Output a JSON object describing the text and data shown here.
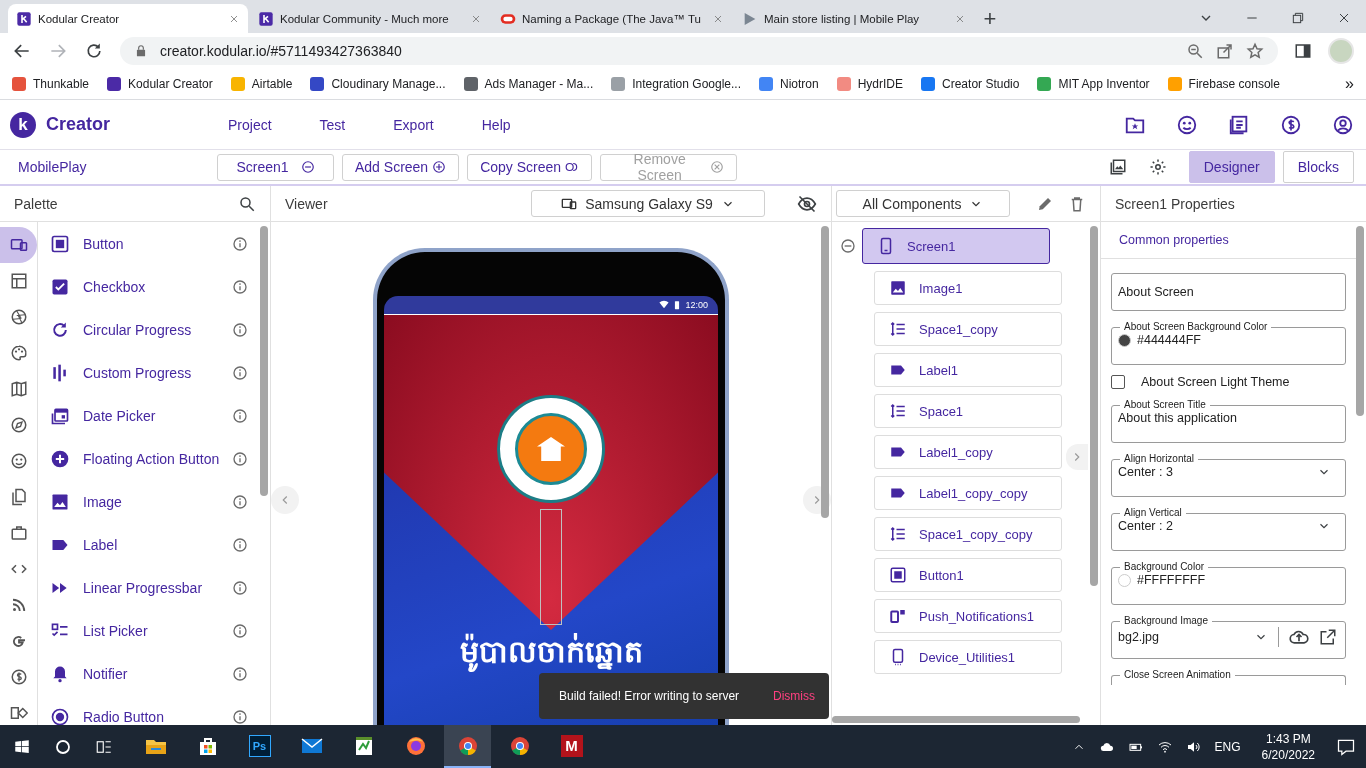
{
  "browser": {
    "tabs": [
      {
        "title": "Kodular Creator",
        "kind": "kodular",
        "selected": true
      },
      {
        "title": "Kodular Community - Much more",
        "kind": "kodular",
        "selected": false
      },
      {
        "title": "Naming a Package (The Java™ Tu",
        "kind": "oracle",
        "selected": false
      },
      {
        "title": "Main store listing | Mobile Play",
        "kind": "play",
        "selected": false
      }
    ],
    "new_tab": "+",
    "url": "creator.kodular.io/#5711493427363840",
    "bookmarks": [
      {
        "label": "Thunkable",
        "color": "#e5533d"
      },
      {
        "label": "Kodular Creator",
        "color": "#4b2aa6"
      },
      {
        "label": "Airtable",
        "color": "#f8b400"
      },
      {
        "label": "Cloudinary Manage...",
        "color": "#3448c5"
      },
      {
        "label": "Ads Manager - Ma...",
        "color": "#5f6368"
      },
      {
        "label": "Integration Google...",
        "color": "#9aa0a6"
      },
      {
        "label": "Niotron",
        "color": "#4285f4"
      },
      {
        "label": "HydrIDE",
        "color": "#f28b82"
      },
      {
        "label": "Creator Studio",
        "color": "#1877f2"
      },
      {
        "label": "MIT App Inventor",
        "color": "#34a853"
      },
      {
        "label": "Firebase console",
        "color": "#ffa000"
      }
    ],
    "more": "»"
  },
  "app": {
    "logo": "k",
    "title": "Creator",
    "menu": [
      "Project",
      "Test",
      "Export",
      "Help"
    ]
  },
  "toolbar": {
    "project": "MobilePlay",
    "screen": "Screen1",
    "buttons": [
      {
        "label": "Add Screen",
        "kind": "add",
        "disabled": false
      },
      {
        "label": "Copy Screen",
        "kind": "copy",
        "disabled": false
      },
      {
        "label": "Remove Screen",
        "kind": "remove",
        "disabled": true
      }
    ],
    "modes": [
      {
        "label": "Designer",
        "selected": true
      },
      {
        "label": "Blocks",
        "selected": false
      }
    ]
  },
  "palette": {
    "title": "Palette",
    "categories": [
      {
        "kind": "ui",
        "selected": true
      },
      {
        "kind": "layout",
        "selected": false
      },
      {
        "kind": "media",
        "selected": false
      },
      {
        "kind": "drawing",
        "selected": false
      },
      {
        "kind": "map",
        "selected": false
      },
      {
        "kind": "sensor",
        "selected": false
      },
      {
        "kind": "social",
        "selected": false
      },
      {
        "kind": "storage",
        "selected": false
      },
      {
        "kind": "utilities",
        "selected": false
      },
      {
        "kind": "code",
        "selected": false
      },
      {
        "kind": "connectivity",
        "selected": false
      },
      {
        "kind": "google",
        "selected": false
      },
      {
        "kind": "monetization",
        "selected": false
      },
      {
        "kind": "extension",
        "selected": false
      }
    ],
    "items": [
      {
        "label": "Button",
        "kind": "button"
      },
      {
        "label": "Checkbox",
        "kind": "checkbox"
      },
      {
        "label": "Circular Progress",
        "kind": "circular"
      },
      {
        "label": "Custom Progress",
        "kind": "bars"
      },
      {
        "label": "Date Picker",
        "kind": "calendar"
      },
      {
        "label": "Floating Action Button",
        "kind": "fab"
      },
      {
        "label": "Image",
        "kind": "image"
      },
      {
        "label": "Label",
        "kind": "label"
      },
      {
        "label": "Linear Progressbar",
        "kind": "play"
      },
      {
        "label": "List Picker",
        "kind": "list"
      },
      {
        "label": "Notifier",
        "kind": "bell"
      },
      {
        "label": "Radio Button",
        "kind": "radio"
      }
    ]
  },
  "viewer": {
    "title": "Viewer",
    "device": "Samsung Galaxy S9",
    "phone": {
      "time": "12:00",
      "title": "ម៉ូបាលចាក់ឆ្នោត"
    }
  },
  "toast": {
    "message": "Build failed! Error writing to server",
    "action": "Dismiss"
  },
  "components": {
    "filter": "All Components",
    "tree": [
      {
        "label": "Screen1",
        "kind": "phone",
        "selected": true,
        "expanded": true,
        "children": [
          {
            "label": "Image1",
            "kind": "image",
            "selected": false
          },
          {
            "label": "Space1_copy",
            "kind": "space",
            "selected": false
          },
          {
            "label": "Label1",
            "kind": "label",
            "selected": false
          },
          {
            "label": "Space1",
            "kind": "space",
            "selected": false
          },
          {
            "label": "Label1_copy",
            "kind": "label",
            "selected": false
          },
          {
            "label": "Label1_copy_copy",
            "kind": "label",
            "selected": false
          },
          {
            "label": "Space1_copy_copy",
            "kind": "space",
            "selected": false
          },
          {
            "label": "Button1",
            "kind": "button",
            "selected": false
          },
          {
            "label": "Push_Notifications1",
            "kind": "push",
            "selected": false
          },
          {
            "label": "Device_Utilities1",
            "kind": "device",
            "selected": false
          }
        ]
      }
    ]
  },
  "properties": {
    "title": "Screen1 Properties",
    "section": "Common properties",
    "fields": [
      {
        "kind": "textarea",
        "placeholder": "About Screen"
      },
      {
        "kind": "color",
        "label": "About Screen Background Color",
        "value": "#444444FF",
        "color": "#444444"
      },
      {
        "kind": "checkbox",
        "label": "About Screen Light Theme",
        "checked": false
      },
      {
        "kind": "text",
        "label": "About Screen Title",
        "value": "About this application"
      },
      {
        "kind": "select",
        "label": "Align Horizontal",
        "value": "Center : 3"
      },
      {
        "kind": "select",
        "label": "Align Vertical",
        "value": "Center : 2"
      },
      {
        "kind": "color",
        "label": "Background Color",
        "value": "#FFFFFFFF",
        "color": "#ffffff"
      },
      {
        "kind": "asset",
        "label": "Background Image",
        "value": "bg2.jpg"
      },
      {
        "kind": "select",
        "label": "Close Screen Animation"
      }
    ]
  },
  "taskbar": {
    "apps": [
      {
        "kind": "explorer",
        "selected": false
      },
      {
        "kind": "store",
        "selected": false
      },
      {
        "kind": "photoshop",
        "label": "Ps",
        "selected": false
      },
      {
        "kind": "mail",
        "selected": false
      },
      {
        "kind": "notepad",
        "selected": false
      },
      {
        "kind": "firefox",
        "selected": false
      },
      {
        "kind": "chrome",
        "selected": true
      },
      {
        "kind": "chrome",
        "selected": false
      },
      {
        "kind": "red-app",
        "label": "M",
        "selected": false
      }
    ],
    "language": "ENG",
    "time": "1:43 PM",
    "date": "6/20/2022"
  }
}
